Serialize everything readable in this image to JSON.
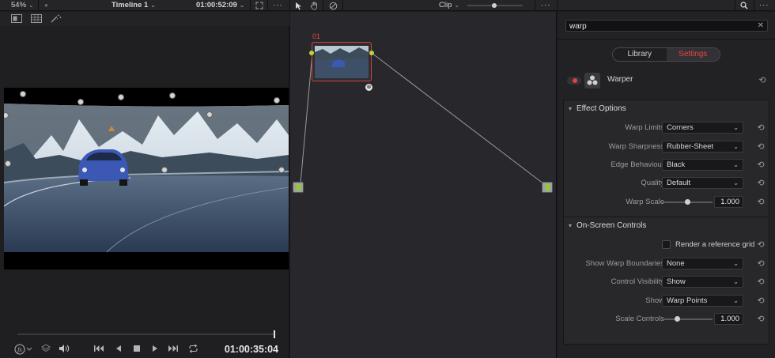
{
  "topbar": {
    "zoom": "54%",
    "timeline": "Timeline 1",
    "source_timecode": "01:00:52:09",
    "clip_label": "Clip",
    "search_icon": "search-icon",
    "more_icon": "more-options-icon"
  },
  "viewer": {
    "playhead_fraction": 1.0,
    "timecode": "01:00:35:04"
  },
  "node_editor": {
    "node_label": "01"
  },
  "inspector": {
    "search": {
      "value": "warp"
    },
    "tabs": [
      {
        "label": "Library",
        "active": false
      },
      {
        "label": "Settings",
        "active": true
      }
    ],
    "effect_name": "Warper",
    "groups": {
      "effect_options": {
        "title": "Effect Options",
        "warp_limits": {
          "label": "Warp Limits",
          "value": "Corners"
        },
        "warp_sharpness": {
          "label": "Warp Sharpness",
          "value": "Rubber-Sheet"
        },
        "edge_behaviour": {
          "label": "Edge Behaviour",
          "value": "Black"
        },
        "quality": {
          "label": "Quality",
          "value": "Default"
        },
        "warp_scale": {
          "label": "Warp Scale",
          "value": "1.000",
          "slider_fraction": 0.5
        }
      },
      "on_screen_controls": {
        "title": "On-Screen Controls",
        "reference_grid": {
          "label": "Render a reference grid",
          "checked": false
        },
        "show_warp_boundaries": {
          "label": "Show Warp Boundaries",
          "value": "None"
        },
        "control_visibility": {
          "label": "Control Visibility",
          "value": "Show"
        },
        "show": {
          "label": "Show",
          "value": "Warp Points"
        },
        "scale_controls": {
          "label": "Scale Controls",
          "value": "1.000",
          "slider_fraction": 0.3
        }
      }
    }
  },
  "colors": {
    "accent_red": "#e8473f",
    "node_border": "#d24141",
    "node_green": "#8ccf2a"
  }
}
